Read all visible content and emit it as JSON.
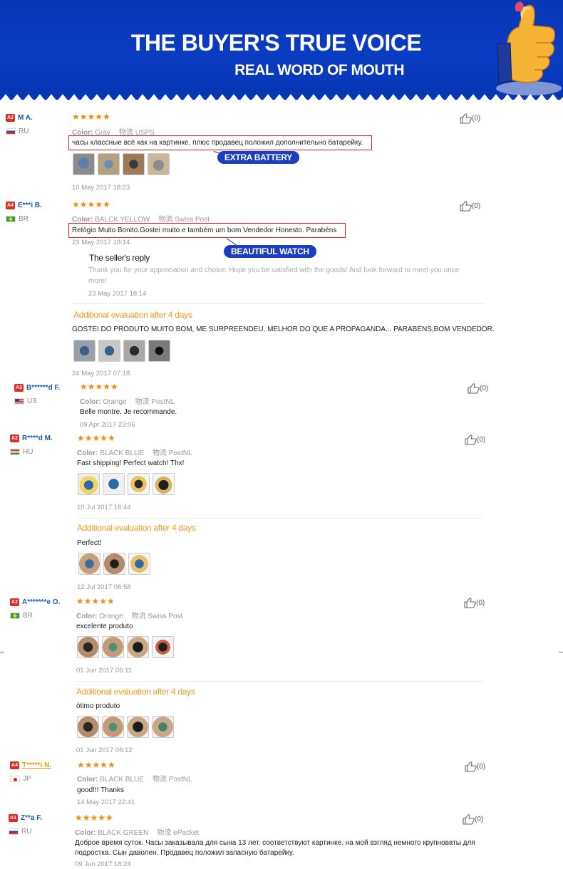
{
  "banner": {
    "title": "THE BUYER'S TRUE VOICE",
    "subtitle": "REAL WORD OF MOUTH",
    "colors": {
      "background": "#0a3cc2",
      "text": "#ffffff"
    },
    "icon": "thumbs-up-hand-icon"
  },
  "labels": {
    "color": "Color:",
    "shipping": "物流",
    "additional": "Additional evaluation after 4 days",
    "seller_reply": "The seller's reply"
  },
  "tags": {
    "extra_battery": "EXTRA BATTERY",
    "beautiful_watch": "BEAUTIFUL WATCH"
  },
  "colors": {
    "star": "#f28b10",
    "level_badge": "#e02d24",
    "username": "#1b57b2",
    "additional": "#f09a20",
    "highlight_box": "#d9252a",
    "tag": "#1c3fbf"
  },
  "reviews": [
    {
      "level": "A2",
      "name": "M A.",
      "country": "RU",
      "stars": "★★★★★",
      "rating": 5,
      "color": "Gray",
      "shipping": "USPS",
      "text": "часы классные всё как на картинке, плюс продавец положил дополнительно батарейку.",
      "date": "10 May 2017 18:23",
      "likes": "(0)",
      "photos": 4
    },
    {
      "level": "A4",
      "name": "E***i B.",
      "country": "BR",
      "stars": "★★★★★",
      "rating": 5,
      "color": "BALCK YELLOW",
      "shipping": "Swiss Post",
      "text": "Relógio Muito Bonito.Gostei muito e também um bom Vendedor Honesto. Parabéns",
      "date": "23 May 2017 18:14",
      "likes": "(0)",
      "reply": {
        "text": "Thank you for your appreciation and choice. Hope you be satisfied with the goods! And look forward to meet you once more!",
        "date": "23 May 2017 18:14"
      },
      "additional": {
        "text": "GOSTEI DO PRODUTO MUITO BOM, ME SURPREENDEU, MELHOR DO QUE A PROPAGANDA... PARABÉNS,BOM VENDEDOR.",
        "date": "24 May 2017 07:18",
        "photos": 4
      }
    },
    {
      "level": "A3",
      "name": "B******d F.",
      "country": "US",
      "stars": "★★★★★",
      "rating": 5,
      "color": "Orange",
      "shipping": "PostNL",
      "text": "Belle montre. Je recommande.",
      "date": "09 Apr 2017 23:06",
      "likes": "(0)"
    },
    {
      "level": "A2",
      "name": "R****d M.",
      "country": "HU",
      "stars": "★★★★★",
      "rating": 5,
      "color": "BLACK BLUE",
      "shipping": "PostNL",
      "text": "Fast shipping! Perfect watch! Thx!",
      "date": "10 Jul 2017 18:44",
      "likes": "(0)",
      "photos": 4,
      "additional": {
        "text": "Perfect!",
        "date": "12 Jul 2017 08:58",
        "photos": 3
      }
    },
    {
      "level": "A2",
      "name": "A*******e O.",
      "country": "BR",
      "stars": "★★★★★",
      "rating": 5,
      "color": "Orange",
      "shipping": "Swiss Post",
      "text": "excelente produto",
      "date": "01 Jun 2017 06:11",
      "likes": "(0)",
      "photos": 4,
      "additional": {
        "text": "ótimo produto",
        "date": "01 Jun 2017 06:12",
        "photos": 4
      }
    },
    {
      "level": "A4",
      "name": "T*****i N.",
      "country": "JP",
      "stars": "★★★★★",
      "rating": 5,
      "color": "BLACK BLUE",
      "shipping": "PostNL",
      "text": "good!!! Thanks",
      "date": "14 May 2017 22:41",
      "likes": "(0)"
    },
    {
      "level": "A1",
      "name": "Z**a F.",
      "country": "RU",
      "stars": "★★★★★",
      "rating": 5,
      "color": "BLACK GREEN",
      "shipping": "ePacket",
      "text": "Доброе время суток. Часы заказывала для сына 13 лет. соответствуют картинке. на мой взгляд немного крупноваты для подростка. Сын даволен. Продавец положил запасную батарейку.",
      "date": "09 Jun 2017 18:24",
      "likes": "(0)"
    }
  ]
}
